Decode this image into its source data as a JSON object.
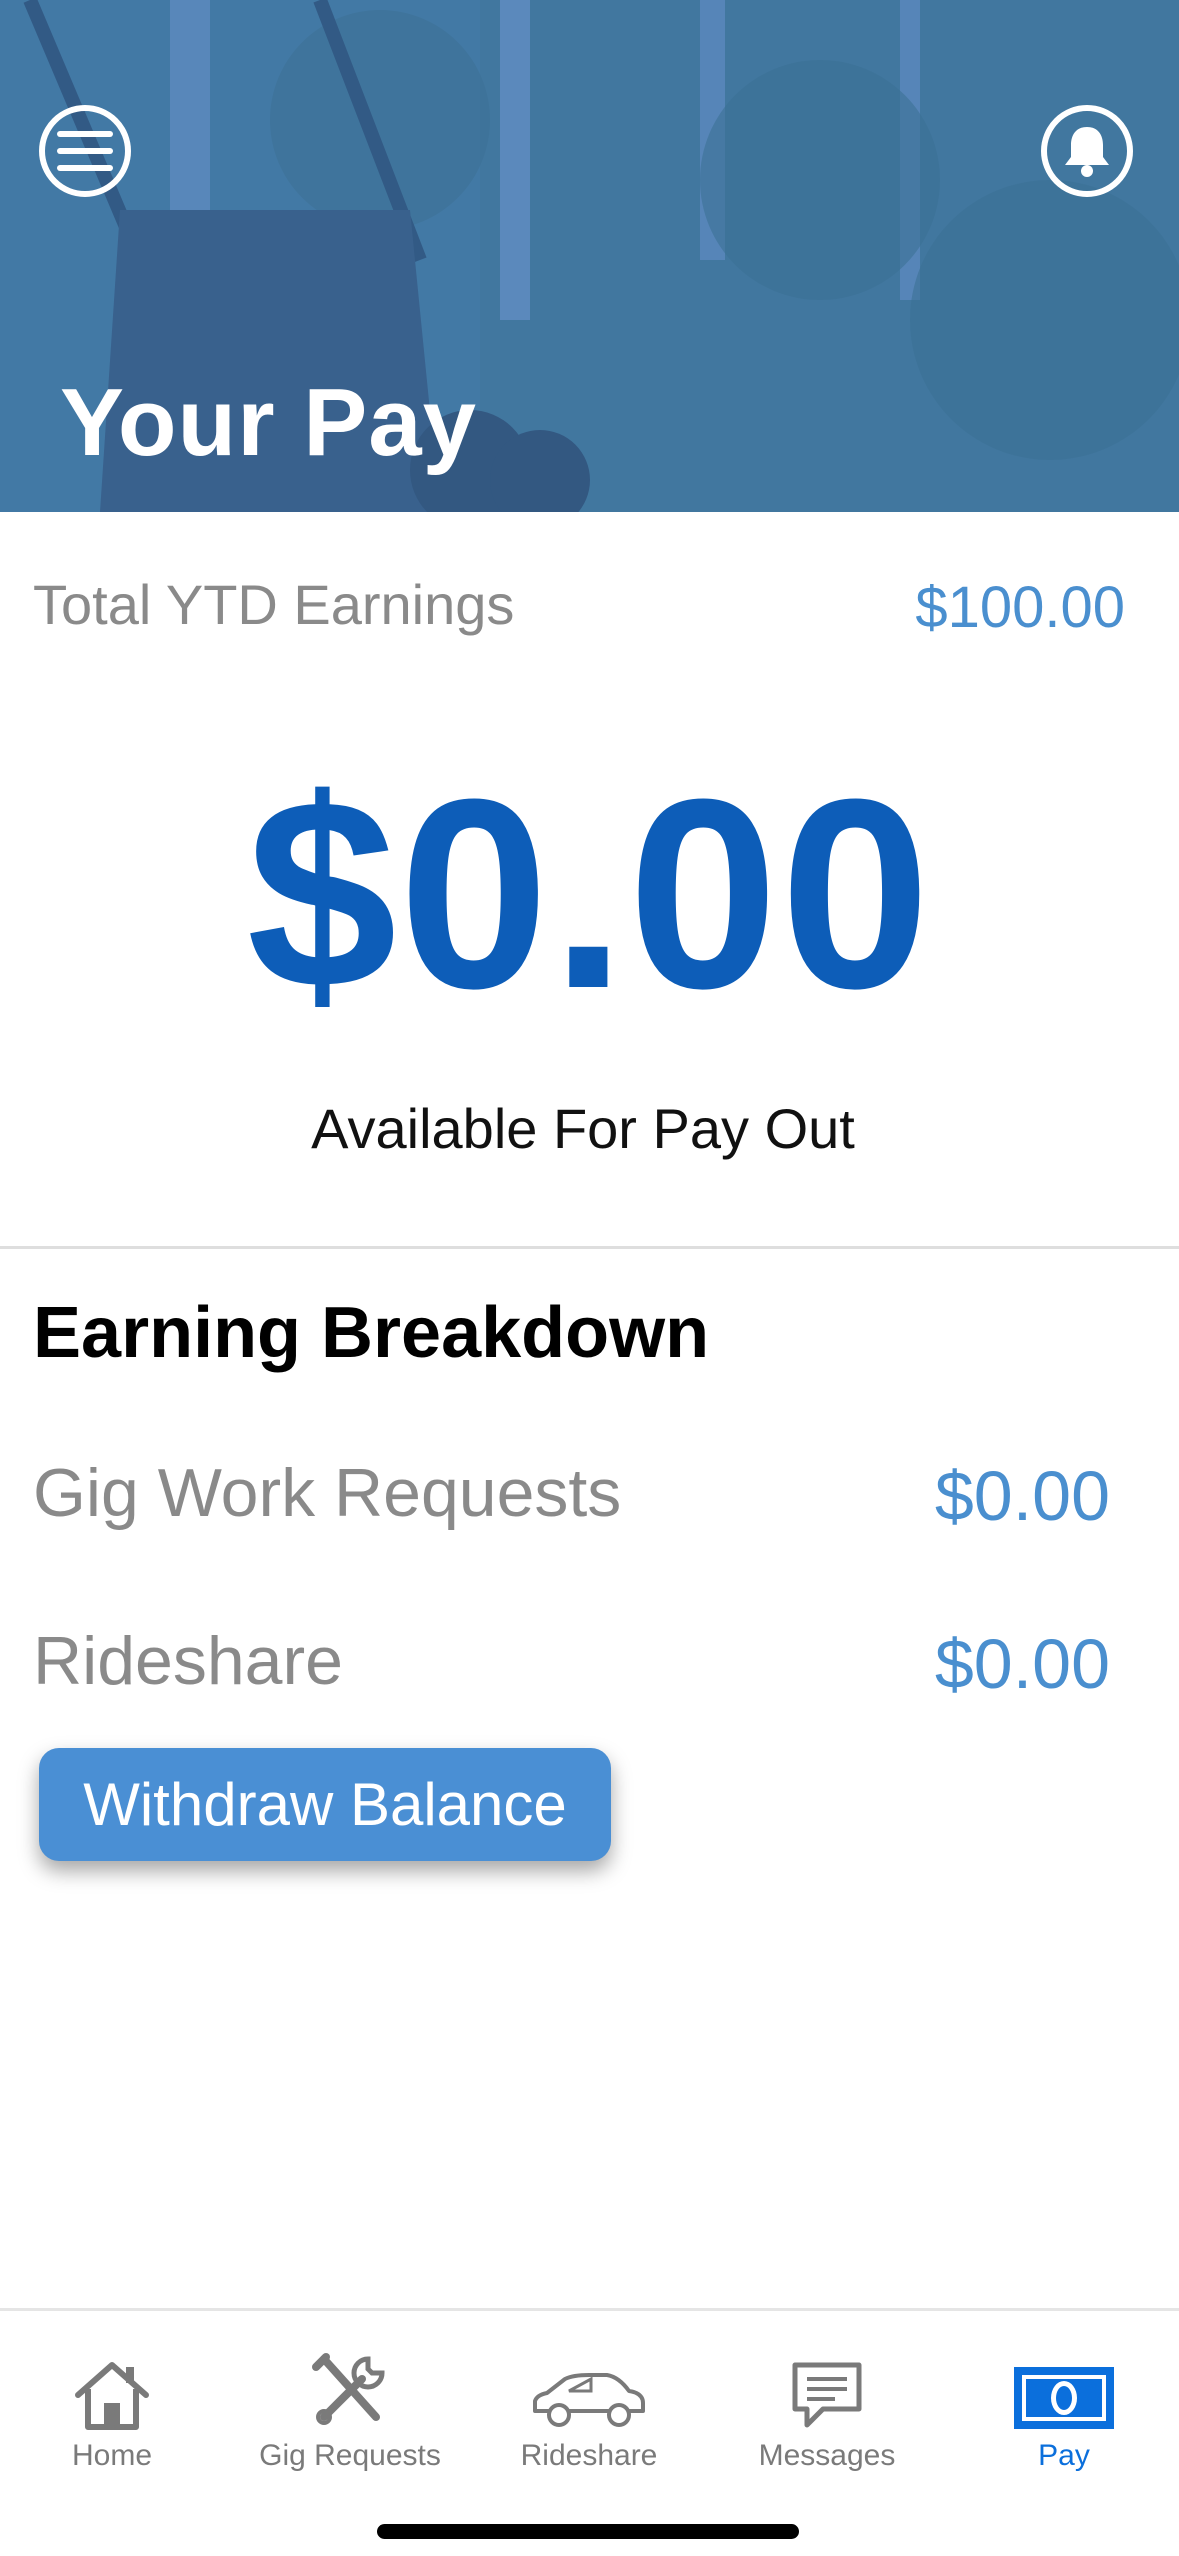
{
  "header": {
    "title": "Your Pay",
    "menu_icon": "hamburger-menu-icon",
    "bell_icon": "notification-bell-icon",
    "tint_color": "#4a84c4"
  },
  "summary": {
    "ytd_label": "Total YTD Earnings",
    "ytd_value": "$100.00",
    "available_amount": "$0.00",
    "available_caption": "Available For Pay Out"
  },
  "breakdown": {
    "title": "Earning Breakdown",
    "rows": [
      {
        "label": "Gig Work Requests",
        "value": "$0.00"
      },
      {
        "label": "Rideshare",
        "value": "$0.00"
      }
    ],
    "withdraw_label": "Withdraw Balance"
  },
  "tabbar": {
    "items": [
      {
        "label": "Home",
        "icon": "home-icon"
      },
      {
        "label": "Gig Requests",
        "icon": "tools-icon"
      },
      {
        "label": "Rideshare",
        "icon": "car-icon"
      },
      {
        "label": "Messages",
        "icon": "message-icon"
      },
      {
        "label": "Pay",
        "icon": "money-icon"
      }
    ],
    "active": "Pay",
    "active_color": "#0b6fdc"
  },
  "colors": {
    "accent_blue": "#4a8fcf",
    "amount_blue": "#0d5db8",
    "button_blue": "#4a8fd4"
  }
}
